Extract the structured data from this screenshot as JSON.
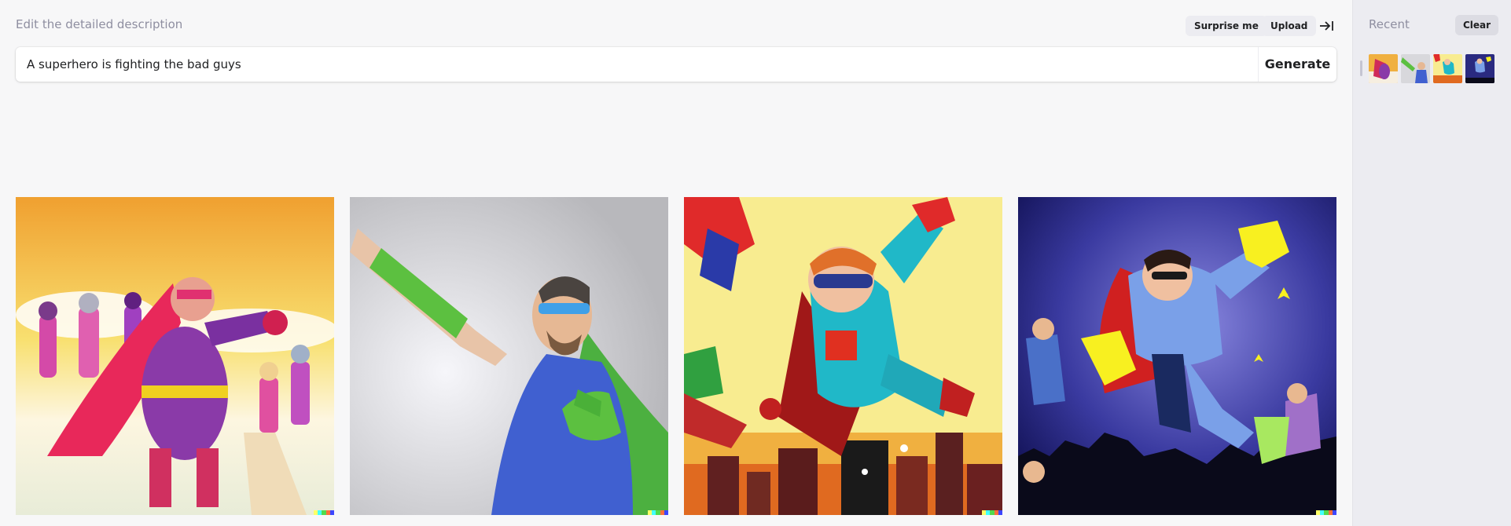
{
  "header": {
    "instruction": "Edit the detailed description",
    "surprise_label": "Surprise me",
    "upload_label": "Upload",
    "collapse_icon": "arrow-to-right-icon"
  },
  "prompt": {
    "value": "A superhero is fighting the bad guys",
    "generate_label": "Generate"
  },
  "results": [
    {
      "description_icon": "superhero-purple-cape-image"
    },
    {
      "description_icon": "man-green-cape-goggles-image"
    },
    {
      "description_icon": "comic-flying-heroes-image"
    },
    {
      "description_icon": "hero-night-city-image"
    }
  ],
  "signature_colors": [
    "#ffff66",
    "#42ffff",
    "#51da4c",
    "#ff6e3c",
    "#3c46ff"
  ],
  "sidebar": {
    "recent_label": "Recent",
    "clear_label": "Clear"
  }
}
